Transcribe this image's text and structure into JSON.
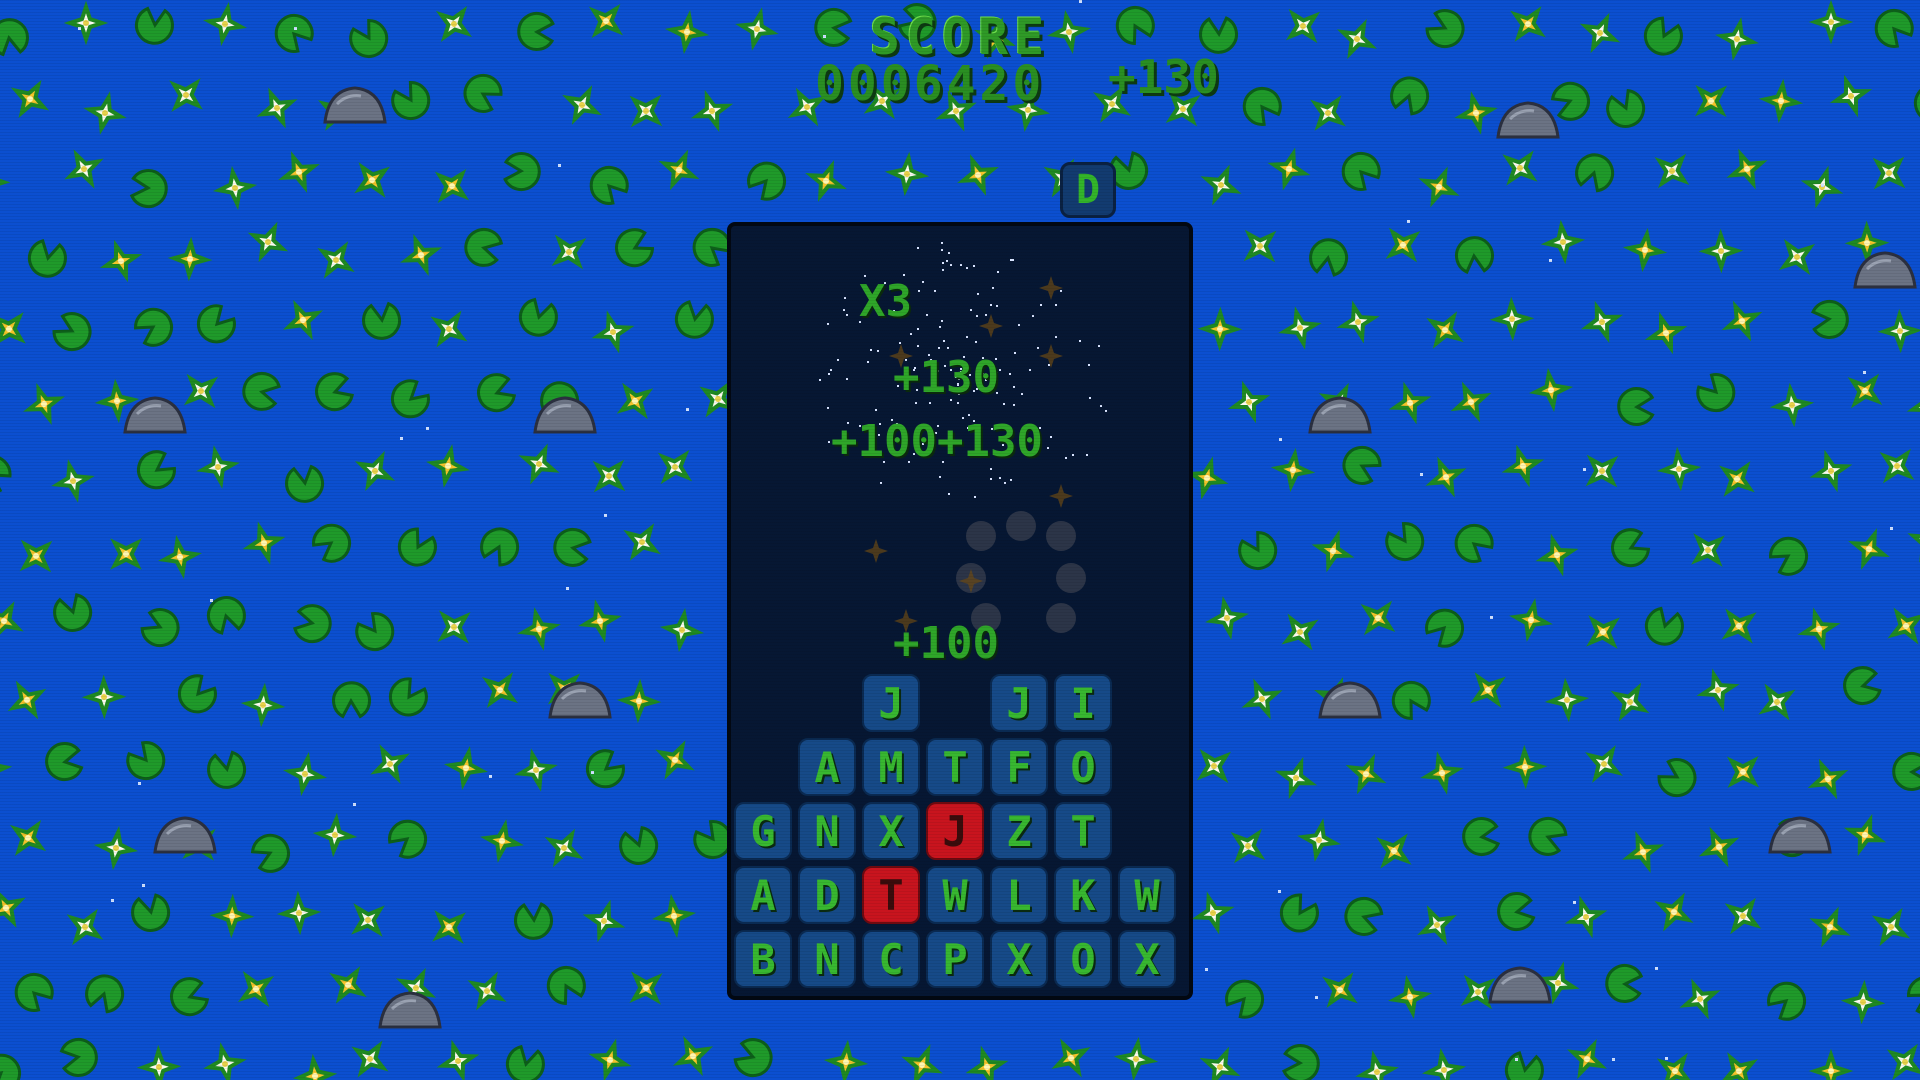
{
  "hud": {
    "score_label": "SCORE",
    "score_value": "0006420",
    "last_bonus": "+130"
  },
  "next_tile": {
    "letter": "D"
  },
  "popups": {
    "multiplier": "X3",
    "combo_bonus": "+130",
    "breakdown": "+100+130",
    "word_bonus": "+100"
  },
  "board": {
    "rows": [
      [
        "",
        "",
        "J",
        "",
        "J",
        "I",
        ""
      ],
      [
        "",
        "A",
        "M",
        "T",
        "F",
        "O",
        ""
      ],
      [
        "G",
        "N",
        "X",
        "J",
        "Z",
        "T",
        ""
      ],
      [
        "A",
        "D",
        "T",
        "W",
        "L",
        "K",
        "W"
      ],
      [
        "B",
        "N",
        "C",
        "P",
        "X",
        "O",
        "X"
      ]
    ],
    "selected": [
      [
        2,
        3
      ],
      [
        3,
        2
      ]
    ]
  },
  "colors": {
    "water": "#0b4fd0",
    "lily_pad": "#1f9a2a",
    "tile": "#164a88",
    "tile_text": "#38b830",
    "selected_tile": "#c8141e",
    "well": "#061733"
  },
  "decor_icons": [
    "lily-pad-icon",
    "white-flower-icon",
    "yellow-flower-icon",
    "rock-icon"
  ]
}
